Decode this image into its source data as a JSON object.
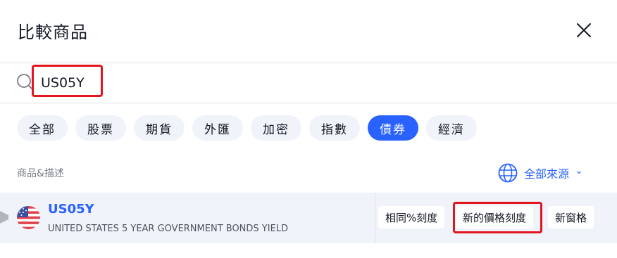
{
  "dialog": {
    "title": "比較商品"
  },
  "search": {
    "value": "US05Y",
    "placeholder": ""
  },
  "filters": [
    "全部",
    "股票",
    "期貨",
    "外匯",
    "加密",
    "指數",
    "債券",
    "經濟"
  ],
  "active_filter": "債券",
  "columns": {
    "symbol_desc": "商品&描述"
  },
  "source": {
    "label": "全部來源",
    "chevron": "⌄"
  },
  "result": {
    "symbol": "US05Y",
    "description": "UNITED STATES 5 YEAR GOVERNMENT BONDS YIELD",
    "country_flag_icon": "us-flag-icon",
    "actions": [
      "相同%刻度",
      "新的價格刻度",
      "新窗格"
    ]
  },
  "colors": {
    "accent": "#2962ff",
    "highlight": "#e3161d",
    "row_bg": "#f0f3fa",
    "chip_bg": "#f0f3fa"
  }
}
